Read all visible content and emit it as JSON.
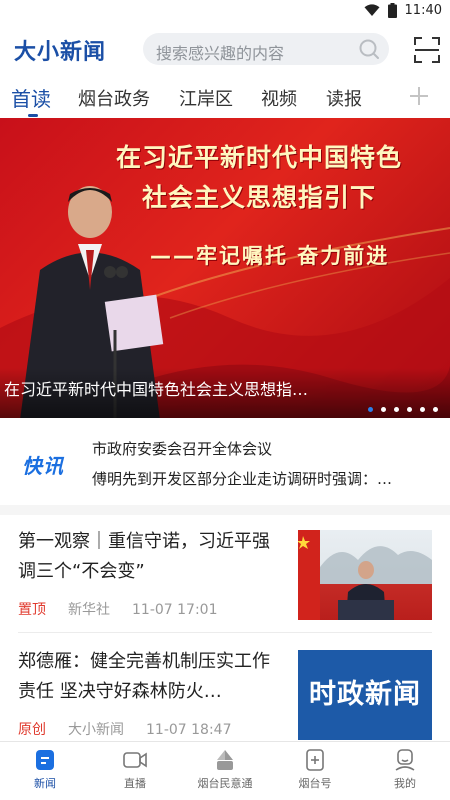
{
  "status": {
    "time": "11:40"
  },
  "header": {
    "logo": "大小新闻",
    "search_placeholder": "搜索感兴趣的内容"
  },
  "tabs": [
    {
      "label": "首读",
      "active": true
    },
    {
      "label": "烟台政务",
      "active": false
    },
    {
      "label": "江岸区",
      "active": false
    },
    {
      "label": "视频",
      "active": false
    },
    {
      "label": "读报",
      "active": false
    }
  ],
  "banner": {
    "title_line1": "在习近平新时代中国特色",
    "title_line2": "社会主义思想指引下",
    "subtitle": "——牢记嘱托 奋力前进",
    "caption": "在习近平新时代中国特色社会主义思想指…",
    "slide_count": 6,
    "active_slide": 1
  },
  "kuaixun": {
    "logo": "快讯",
    "items": [
      "市政府安委会召开全体会议",
      "傅明先到开发区部分企业走访调研时强调：…"
    ]
  },
  "news": [
    {
      "title": "第一观察｜重信守诺，习近平强调三个“不会变”",
      "tag": "置顶",
      "source": "新华社",
      "time": "11-07 17:01"
    },
    {
      "title": "郑德雁：健全完善机制压实工作责任 坚决守好森林防火…",
      "tag": "原创",
      "source": "大小新闻",
      "time": "11-07 18:47",
      "thumb_text": "时政新闻"
    }
  ],
  "bottom_nav": [
    {
      "label": "新闻",
      "icon": "news-icon",
      "active": true
    },
    {
      "label": "直播",
      "icon": "live-icon",
      "active": false
    },
    {
      "label": "烟台民意通",
      "icon": "opinion-icon",
      "active": false
    },
    {
      "label": "烟台号",
      "icon": "account-icon",
      "active": false
    },
    {
      "label": "我的",
      "icon": "profile-icon",
      "active": false
    }
  ],
  "colors": {
    "brand": "#1b4fa6",
    "tag_red": "#e03a2e",
    "banner_red": "#d41a1d"
  }
}
